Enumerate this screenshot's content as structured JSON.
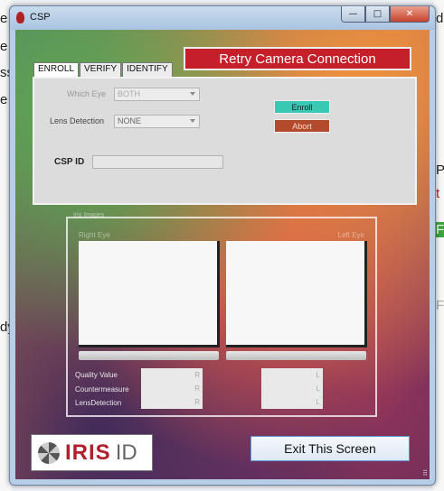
{
  "window": {
    "title": "CSP",
    "controls": {
      "minimize": "—",
      "maximize": "□",
      "close": "✕"
    }
  },
  "background": {
    "left_fragments": [
      "e",
      "e",
      "ss",
      "e",
      "dy"
    ],
    "right_fragments": [
      "d",
      "Pa",
      "t",
      "F",
      "F"
    ]
  },
  "retry_button": "Retry Camera Connection",
  "tabs": [
    {
      "label": "ENROLL",
      "active": true
    },
    {
      "label": "VERIFY",
      "active": false
    },
    {
      "label": "IDENTIFY",
      "active": false
    }
  ],
  "enroll": {
    "which_eye_label": "Which Eye",
    "which_eye_value": "BOTH",
    "lens_detection_label": "Lens Detection",
    "lens_detection_value": "NONE",
    "enroll_button": "Enroll",
    "abort_button": "Abort",
    "csp_id_label": "CSP ID",
    "csp_id_value": ""
  },
  "iris_panel": {
    "legend": "Iris Images",
    "right_eye_label": "Right Eye",
    "left_eye_label": "Left Eye",
    "stats": [
      {
        "label": "Quality Value",
        "right": "R",
        "left": "L"
      },
      {
        "label": "Countermeasure",
        "right": "R",
        "left": "L"
      },
      {
        "label": "LensDetection",
        "right": "R",
        "left": "L"
      }
    ]
  },
  "logo": {
    "iris": "IRIS",
    "id": "ID"
  },
  "exit_button": "Exit This Screen",
  "colors": {
    "retry": "#c51f2a",
    "enroll": "#39c8b3",
    "abort": "#b44a2c",
    "logo_red": "#b21e2a"
  }
}
